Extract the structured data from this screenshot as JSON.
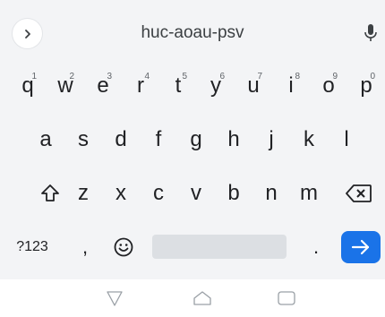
{
  "suggestion_bar": {
    "suggestion": "huc-aoau-psv"
  },
  "keys": {
    "row1": [
      {
        "label": "q",
        "hint": "1"
      },
      {
        "label": "w",
        "hint": "2"
      },
      {
        "label": "e",
        "hint": "3"
      },
      {
        "label": "r",
        "hint": "4"
      },
      {
        "label": "t",
        "hint": "5"
      },
      {
        "label": "y",
        "hint": "6"
      },
      {
        "label": "u",
        "hint": "7"
      },
      {
        "label": "i",
        "hint": "8"
      },
      {
        "label": "o",
        "hint": "9"
      },
      {
        "label": "p",
        "hint": "0"
      }
    ],
    "row2": [
      "a",
      "s",
      "d",
      "f",
      "g",
      "h",
      "j",
      "k",
      "l"
    ],
    "row3": [
      "z",
      "x",
      "c",
      "v",
      "b",
      "n",
      "m"
    ],
    "bottom": {
      "symbols": "?123",
      "comma": ",",
      "period": "."
    }
  },
  "icons": {
    "expand": "chevron-right-icon",
    "mic": "mic-icon",
    "shift": "shift-icon",
    "backspace": "backspace-icon",
    "emoji": "emoji-icon",
    "enter": "arrow-right-icon",
    "nav_back": "triangle-back-icon",
    "nav_home": "home-icon",
    "nav_recents": "recents-icon"
  },
  "colors": {
    "keyboard_bg": "#f3f4f6",
    "enter_key": "#1a73e8",
    "spacebar": "#dcdfe3",
    "text": "#202124"
  }
}
